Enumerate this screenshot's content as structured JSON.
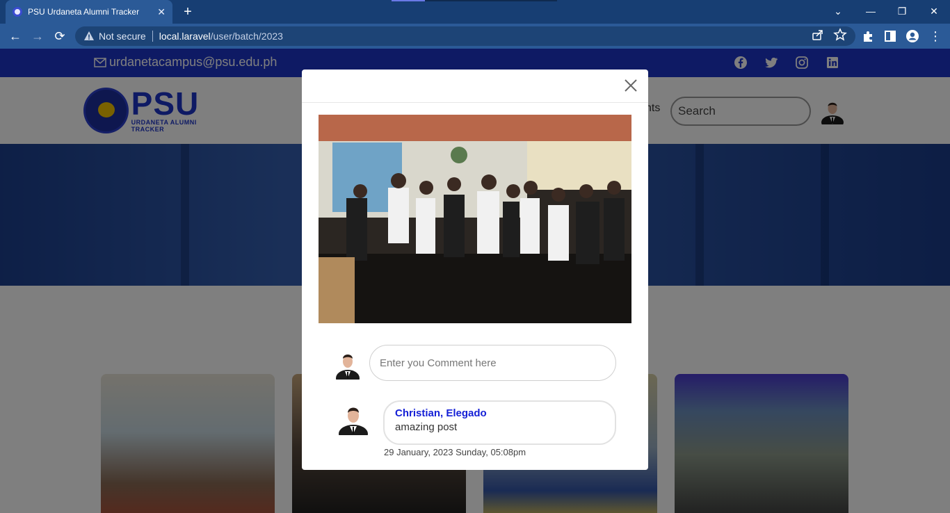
{
  "browser": {
    "tab_title": "PSU Urdaneta Alumni Tracker",
    "address_security": "Not secure",
    "address_host": "local.laravel",
    "address_path": "/user/batch/2023"
  },
  "site": {
    "email": "urdanetacampus@psu.edu.ph",
    "logo_text": "PSU",
    "logo_subtitle": "URDANETA ALUMNI TRACKER",
    "nav_partial": "nts",
    "search_placeholder": "Search",
    "social_icons": [
      "facebook-icon",
      "twitter-icon",
      "instagram-icon",
      "linkedin-icon"
    ]
  },
  "modal": {
    "comment_placeholder": "Enter you Comment here",
    "comments": [
      {
        "author": "Christian, Elegado",
        "text": "amazing post",
        "date": "29 January, 2023 Sunday, 05:08pm"
      }
    ]
  },
  "colors": {
    "brand_blue": "#1d34c8",
    "chrome_dark": "#173e73",
    "chrome_toolbar": "#2b5a97",
    "comment_author": "#1520d6"
  }
}
